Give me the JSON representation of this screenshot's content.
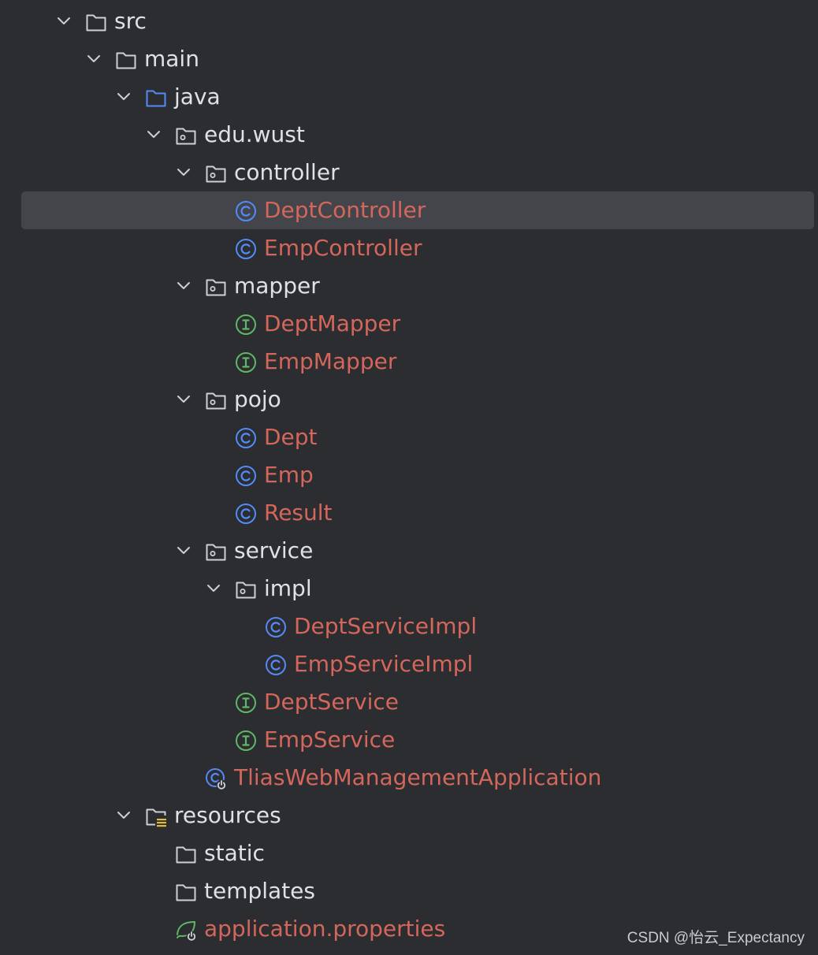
{
  "colors": {
    "background": "#2b2d30",
    "selection": "#43454a",
    "folder_text": "#dfe1e5",
    "class_text": "#d4665c",
    "class_icon": "#548af7",
    "interface_icon": "#5fb865",
    "source_folder_icon": "#548af7"
  },
  "tree": [
    {
      "label": "src",
      "depth": 0,
      "kind": "folder",
      "expanded": true
    },
    {
      "label": "main",
      "depth": 1,
      "kind": "folder",
      "expanded": true
    },
    {
      "label": "java",
      "depth": 2,
      "kind": "source-folder",
      "expanded": true
    },
    {
      "label": "edu.wust",
      "depth": 3,
      "kind": "package",
      "expanded": true
    },
    {
      "label": "controller",
      "depth": 4,
      "kind": "package",
      "expanded": true
    },
    {
      "label": "DeptController",
      "depth": 5,
      "kind": "class",
      "selected": true
    },
    {
      "label": "EmpController",
      "depth": 5,
      "kind": "class"
    },
    {
      "label": "mapper",
      "depth": 4,
      "kind": "package",
      "expanded": true
    },
    {
      "label": "DeptMapper",
      "depth": 5,
      "kind": "interface"
    },
    {
      "label": "EmpMapper",
      "depth": 5,
      "kind": "interface"
    },
    {
      "label": "pojo",
      "depth": 4,
      "kind": "package",
      "expanded": true
    },
    {
      "label": "Dept",
      "depth": 5,
      "kind": "class"
    },
    {
      "label": "Emp",
      "depth": 5,
      "kind": "class"
    },
    {
      "label": "Result",
      "depth": 5,
      "kind": "class"
    },
    {
      "label": "service",
      "depth": 4,
      "kind": "package",
      "expanded": true
    },
    {
      "label": "impl",
      "depth": 5,
      "kind": "package",
      "expanded": true
    },
    {
      "label": "DeptServiceImpl",
      "depth": 6,
      "kind": "class"
    },
    {
      "label": "EmpServiceImpl",
      "depth": 6,
      "kind": "class"
    },
    {
      "label": "DeptService",
      "depth": 5,
      "kind": "interface"
    },
    {
      "label": "EmpService",
      "depth": 5,
      "kind": "interface"
    },
    {
      "label": "TliasWebManagementApplication",
      "depth": 4,
      "kind": "spring-app"
    },
    {
      "label": "resources",
      "depth": 2,
      "kind": "resources-folder",
      "expanded": true
    },
    {
      "label": "static",
      "depth": 3,
      "kind": "folder"
    },
    {
      "label": "templates",
      "depth": 3,
      "kind": "folder"
    },
    {
      "label": "application.properties",
      "depth": 3,
      "kind": "spring-properties"
    }
  ],
  "watermark": "CSDN @怡云_Expectancy"
}
